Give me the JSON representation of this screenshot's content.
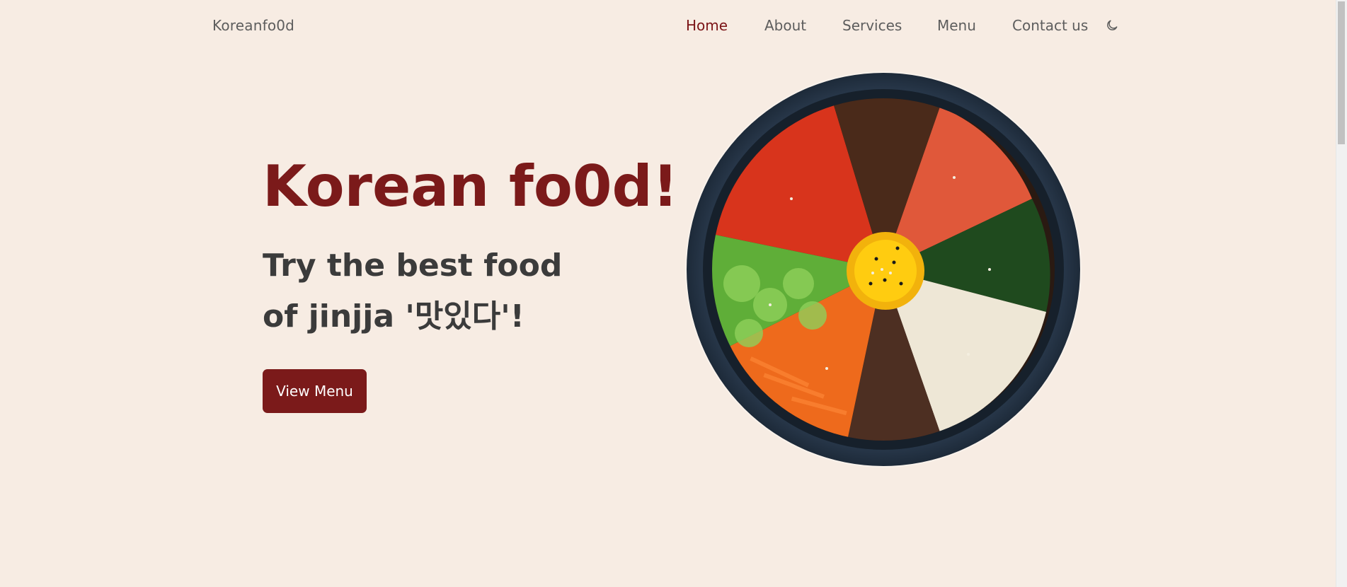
{
  "header": {
    "logo": "Koreanfo0d",
    "nav": [
      {
        "label": "Home",
        "active": true
      },
      {
        "label": "About",
        "active": false
      },
      {
        "label": "Services",
        "active": false
      },
      {
        "label": "Menu",
        "active": false
      },
      {
        "label": "Contact us",
        "active": false
      }
    ],
    "theme_icon": "moon-icon"
  },
  "hero": {
    "title": "Korean fo0d!",
    "subtitle": "Try the best food of jinjja '맛있다'!",
    "button_label": "View Menu",
    "image": "bibimbap-bowl-image"
  },
  "colors": {
    "background": "#f7ece3",
    "accent": "#7b1a1a",
    "nav_active": "#7b1316",
    "text": "#3b3b3b"
  }
}
